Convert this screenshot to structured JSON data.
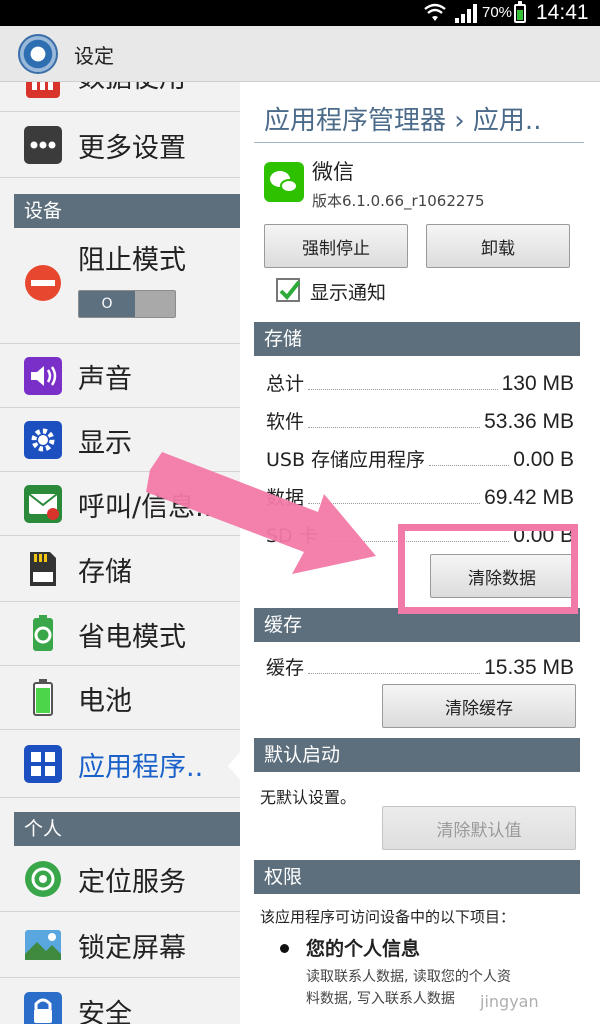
{
  "status_bar": {
    "battery": "70%",
    "time": "14:41"
  },
  "action_bar": {
    "title": "设定"
  },
  "sidebar": {
    "items_top": [
      {
        "label": "数据使用",
        "icon": "data-usage-icon"
      },
      {
        "label": "更多设置",
        "icon": "more-icon"
      }
    ],
    "section_device": "设备",
    "block_mode": {
      "label": "阻止模式",
      "toggle_state": "O"
    },
    "items_device": [
      {
        "label": "声音",
        "icon": "speaker-icon"
      },
      {
        "label": "显示",
        "icon": "display-gear-icon"
      },
      {
        "label": "呼叫/信息..",
        "icon": "call-message-icon"
      },
      {
        "label": "存储",
        "icon": "storage-icon"
      },
      {
        "label": "省电模式",
        "icon": "power-saving-icon"
      },
      {
        "label": "电池",
        "icon": "battery-icon"
      },
      {
        "label": "应用程序..",
        "icon": "apps-grid-icon"
      }
    ],
    "section_personal": "个人",
    "items_personal": [
      {
        "label": "定位服务",
        "icon": "location-icon"
      },
      {
        "label": "锁定屏幕",
        "icon": "lock-screen-icon"
      },
      {
        "label": "安全",
        "icon": "padlock-icon"
      }
    ]
  },
  "detail": {
    "breadcrumb": "应用程序管理器 › 应用..",
    "app_name": "微信",
    "app_version": "版本6.1.0.66_r1062275",
    "force_stop": "强制停止",
    "uninstall": "卸载",
    "show_notifications": "显示通知",
    "storage": {
      "header": "存储",
      "rows": [
        {
          "label": "总计",
          "value": "130 MB"
        },
        {
          "label": "软件",
          "value": "53.36 MB"
        },
        {
          "label": "USB 存储应用程序",
          "value": "0.00 B"
        },
        {
          "label": "数据",
          "value": "69.42 MB"
        },
        {
          "label": "SD 卡",
          "value": "0.00 B"
        }
      ],
      "clear_data": "清除数据"
    },
    "cache": {
      "header": "缓存",
      "label": "缓存",
      "value": "15.35 MB",
      "clear_cache": "清除缓存"
    },
    "default_launch": {
      "header": "默认启动",
      "text": "无默认设置。",
      "clear_defaults": "清除默认值"
    },
    "permissions": {
      "header": "权限",
      "intro": "该应用程序可访问设备中的以下项目：",
      "group_title": "您的个人信息",
      "group_desc_1": "读取联系人数据, 读取您的个人资",
      "group_desc_2": "料数据, 写入联系人数据"
    }
  },
  "watermark": "jingyan",
  "colors": {
    "section": "#5d6f7c",
    "accent_blue": "#1a62c9",
    "highlight_pink": "#f27aa8"
  }
}
